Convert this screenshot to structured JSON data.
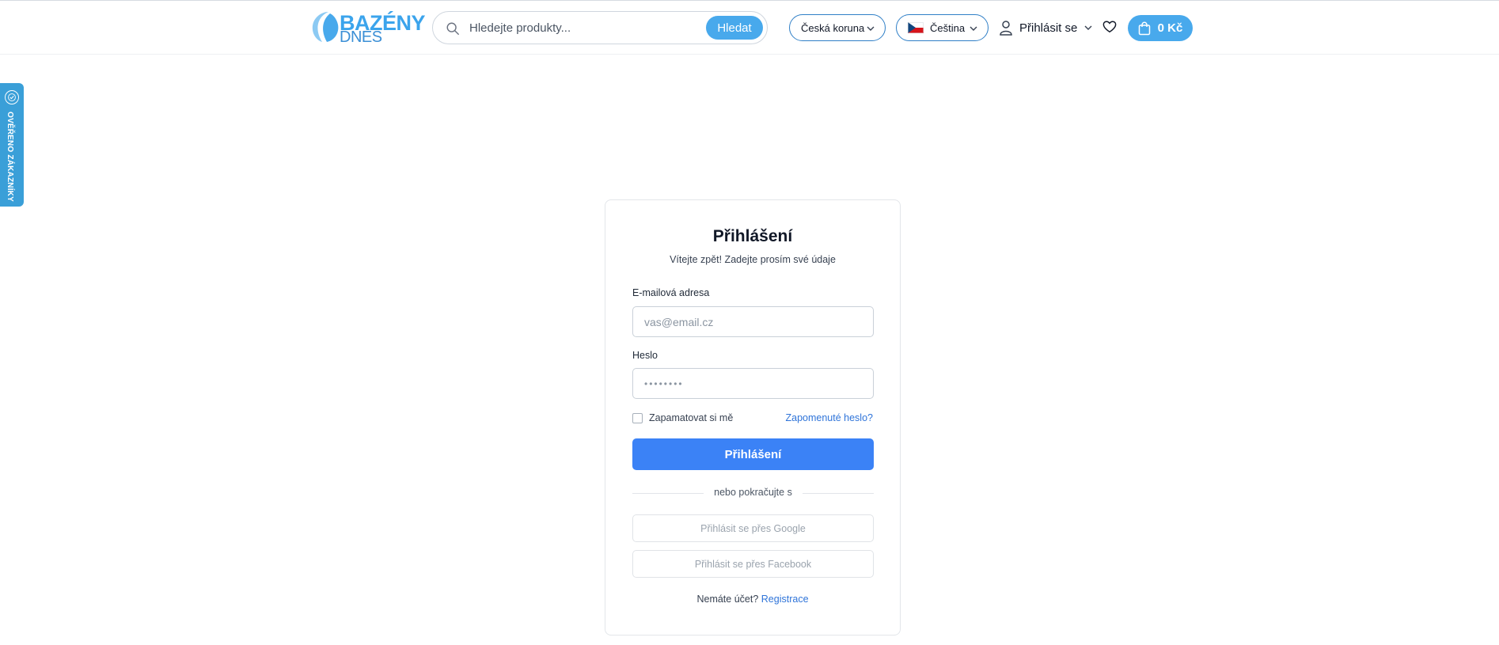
{
  "header": {
    "logo": {
      "line1": "BAZÉNY",
      "line2": "DNES",
      "icon": "pool-logo-icon"
    },
    "search": {
      "placeholder": "Hledejte produkty...",
      "value": "",
      "button_label": "Hledat",
      "icon": "search-icon"
    },
    "currency": {
      "selected": "Česká koruna",
      "icon": "chevron-down-icon"
    },
    "language": {
      "selected": "Čeština",
      "flag": "czech-flag-icon",
      "icon": "chevron-down-icon"
    },
    "account": {
      "label": "Přihlásit se",
      "icon": "user-icon"
    },
    "wishlist": {
      "icon": "heart-icon"
    },
    "cart": {
      "label": "0 Kč",
      "icon": "shopping-bag-icon"
    }
  },
  "side_tab": {
    "label": "OVĚŘENO ZÁKAZNÍKY",
    "icon": "verified-badge-icon"
  },
  "login_form": {
    "title": "Přihlášení",
    "subtitle": "Vítejte zpět! Zadejte prosím své údaje",
    "email": {
      "label": "E-mailová adresa",
      "placeholder": "vas@email.cz",
      "value": ""
    },
    "password": {
      "label": "Heslo",
      "placeholder": "••••••••",
      "value": ""
    },
    "remember_label": "Zapamatovat si mě",
    "remember_checked": false,
    "forgot_label": "Zapomenuté heslo?",
    "submit_label": "Přihlášení",
    "divider_text": "nebo pokračujte s",
    "google_label": "Přihlásit se přes Google",
    "facebook_label": "Přihlásit se přes Facebook",
    "signup_prompt": "Nemáte účet?",
    "signup_link": "Registrace"
  },
  "colors": {
    "brand_blue": "#48a9ec",
    "primary_button": "#3b82f6",
    "link": "#2f74d9",
    "side_tab": "#3a9fd8"
  }
}
